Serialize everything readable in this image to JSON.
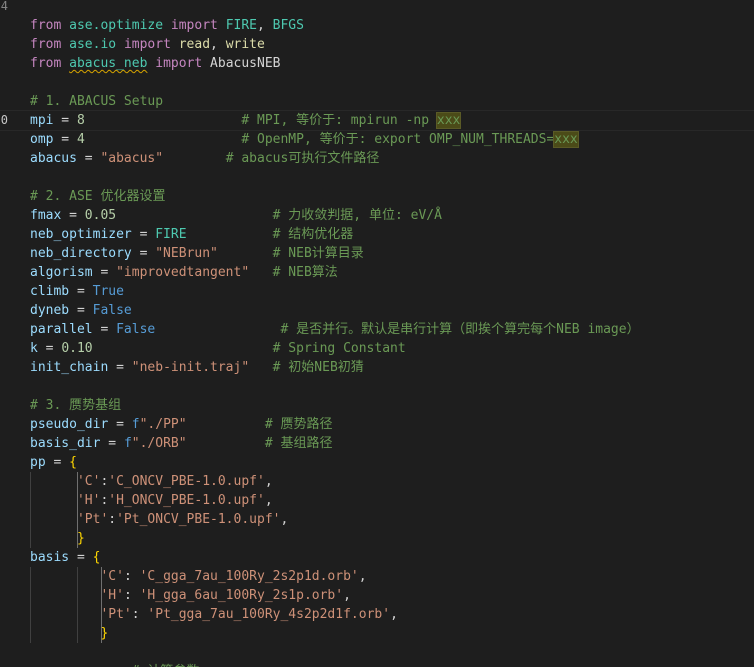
{
  "editor": {
    "language": "python",
    "current_line_index": 6,
    "gutter_visible": [
      {
        "index": 0,
        "number": "4"
      },
      {
        "index": 6,
        "number": "0"
      }
    ],
    "lines": [
      [],
      [
        [
          "kw",
          "from"
        ],
        [
          "op",
          " "
        ],
        [
          "mod",
          "ase.optimize"
        ],
        [
          "op",
          " "
        ],
        [
          "kw",
          "import"
        ],
        [
          "op",
          " "
        ],
        [
          "cls",
          "FIRE"
        ],
        [
          "op",
          ", "
        ],
        [
          "cls",
          "BFGS"
        ]
      ],
      [
        [
          "kw",
          "from"
        ],
        [
          "op",
          " "
        ],
        [
          "mod",
          "ase.io"
        ],
        [
          "op",
          " "
        ],
        [
          "kw",
          "import"
        ],
        [
          "op",
          " "
        ],
        [
          "fn",
          "read"
        ],
        [
          "op",
          ", "
        ],
        [
          "fn",
          "write"
        ]
      ],
      [
        [
          "kw",
          "from"
        ],
        [
          "op",
          " "
        ],
        [
          "mod squig",
          "abacus_neb"
        ],
        [
          "op",
          " "
        ],
        [
          "kw",
          "import"
        ],
        [
          "op",
          " "
        ],
        [
          "op",
          "AbacusNEB"
        ]
      ],
      [],
      [
        [
          "com",
          "# 1. ABACUS Setup"
        ]
      ],
      [
        [
          "var",
          "mpi"
        ],
        [
          "op",
          " = "
        ],
        [
          "num",
          "8"
        ],
        [
          "op",
          "                    "
        ],
        [
          "com",
          "# MPI, 等价于: mpirun -np "
        ],
        [
          "com hl",
          "xxx"
        ]
      ],
      [
        [
          "var",
          "omp"
        ],
        [
          "op",
          " = "
        ],
        [
          "num",
          "4"
        ],
        [
          "op",
          "                    "
        ],
        [
          "com",
          "# OpenMP, 等价于: export OMP_NUM_THREADS="
        ],
        [
          "com hl",
          "xxx"
        ]
      ],
      [
        [
          "var",
          "abacus"
        ],
        [
          "op",
          " = "
        ],
        [
          "str",
          "\"abacus\""
        ],
        [
          "op",
          "        "
        ],
        [
          "com",
          "# abacus可执行文件路径"
        ]
      ],
      [],
      [
        [
          "com",
          "# 2. ASE 优化器设置"
        ]
      ],
      [
        [
          "var",
          "fmax"
        ],
        [
          "op",
          " = "
        ],
        [
          "num",
          "0.05"
        ],
        [
          "op",
          "                    "
        ],
        [
          "com",
          "# 力收敛判据, 单位: eV/Å"
        ]
      ],
      [
        [
          "var",
          "neb_optimizer"
        ],
        [
          "op",
          " = "
        ],
        [
          "cls",
          "FIRE"
        ],
        [
          "op",
          "           "
        ],
        [
          "com",
          "# 结构优化器"
        ]
      ],
      [
        [
          "var",
          "neb_directory"
        ],
        [
          "op",
          " = "
        ],
        [
          "str",
          "\"NEBrun\""
        ],
        [
          "op",
          "       "
        ],
        [
          "com",
          "# NEB计算目录"
        ]
      ],
      [
        [
          "var",
          "algorism"
        ],
        [
          "op",
          " = "
        ],
        [
          "str",
          "\"improvedtangent\""
        ],
        [
          "op",
          "   "
        ],
        [
          "com",
          "# NEB算法"
        ]
      ],
      [
        [
          "var",
          "climb"
        ],
        [
          "op",
          " = "
        ],
        [
          "bool",
          "True"
        ]
      ],
      [
        [
          "var",
          "dyneb"
        ],
        [
          "op",
          " = "
        ],
        [
          "bool",
          "False"
        ]
      ],
      [
        [
          "var",
          "parallel"
        ],
        [
          "op",
          " = "
        ],
        [
          "bool",
          "False"
        ],
        [
          "op",
          "                "
        ],
        [
          "com",
          "# 是否并行。默认是串行计算（即挨个算完每个NEB image）"
        ]
      ],
      [
        [
          "var",
          "k"
        ],
        [
          "op",
          " = "
        ],
        [
          "num",
          "0.10"
        ],
        [
          "op",
          "                       "
        ],
        [
          "com",
          "# Spring Constant"
        ]
      ],
      [
        [
          "var",
          "init_chain"
        ],
        [
          "op",
          " = "
        ],
        [
          "str",
          "\"neb-init.traj\""
        ],
        [
          "op",
          "   "
        ],
        [
          "com",
          "# 初始NEB初猜"
        ]
      ],
      [],
      [
        [
          "com",
          "# 3. 赝势基组"
        ]
      ],
      [
        [
          "var",
          "pseudo_dir"
        ],
        [
          "op",
          " = "
        ],
        [
          "fpre",
          "f"
        ],
        [
          "str",
          "\"./PP\""
        ],
        [
          "op",
          "          "
        ],
        [
          "com",
          "# 赝势路径"
        ]
      ],
      [
        [
          "var",
          "basis_dir"
        ],
        [
          "op",
          " = "
        ],
        [
          "fpre",
          "f"
        ],
        [
          "str",
          "\"./ORB\""
        ],
        [
          "op",
          "          "
        ],
        [
          "com",
          "# 基组路径"
        ]
      ],
      [
        [
          "var",
          "pp"
        ],
        [
          "op",
          " = "
        ],
        [
          "brk",
          "{"
        ]
      ],
      [
        [
          "op",
          "      "
        ],
        [
          "str",
          "'C'"
        ],
        [
          "op",
          ":"
        ],
        [
          "str",
          "'C_ONCV_PBE-1.0.upf'"
        ],
        [
          "op",
          ","
        ]
      ],
      [
        [
          "op",
          "      "
        ],
        [
          "str",
          "'H'"
        ],
        [
          "op",
          ":"
        ],
        [
          "str",
          "'H_ONCV_PBE-1.0.upf'"
        ],
        [
          "op",
          ","
        ]
      ],
      [
        [
          "op",
          "      "
        ],
        [
          "str",
          "'Pt'"
        ],
        [
          "op",
          ":"
        ],
        [
          "str",
          "'Pt_ONCV_PBE-1.0.upf'"
        ],
        [
          "op",
          ","
        ]
      ],
      [
        [
          "op",
          "      "
        ],
        [
          "brk",
          "}"
        ]
      ],
      [
        [
          "var",
          "basis"
        ],
        [
          "op",
          " = "
        ],
        [
          "brk",
          "{"
        ]
      ],
      [
        [
          "op",
          "         "
        ],
        [
          "str",
          "'C'"
        ],
        [
          "op",
          ": "
        ],
        [
          "str",
          "'C_gga_7au_100Ry_2s2p1d.orb'"
        ],
        [
          "op",
          ","
        ]
      ],
      [
        [
          "op",
          "         "
        ],
        [
          "str",
          "'H'"
        ],
        [
          "op",
          ": "
        ],
        [
          "str",
          "'H_gga_6au_100Ry_2s1p.orb'"
        ],
        [
          "op",
          ","
        ]
      ],
      [
        [
          "op",
          "         "
        ],
        [
          "str",
          "'Pt'"
        ],
        [
          "op",
          ": "
        ],
        [
          "str",
          "'Pt_gga_7au_100Ry_4s2p2d1f.orb'"
        ],
        [
          "op",
          ","
        ]
      ],
      [
        [
          "op",
          "         "
        ],
        [
          "brk",
          "}"
        ]
      ],
      [],
      [
        [
          "op",
          "             "
        ],
        [
          "com",
          "# 计算参数"
        ]
      ]
    ],
    "guides": [
      {
        "from": 25,
        "to": 28,
        "cols": [
          0,
          6
        ],
        "active_col": 6
      },
      {
        "from": 30,
        "to": 33,
        "cols": [
          0,
          6,
          9
        ],
        "active_col": 9
      }
    ]
  }
}
